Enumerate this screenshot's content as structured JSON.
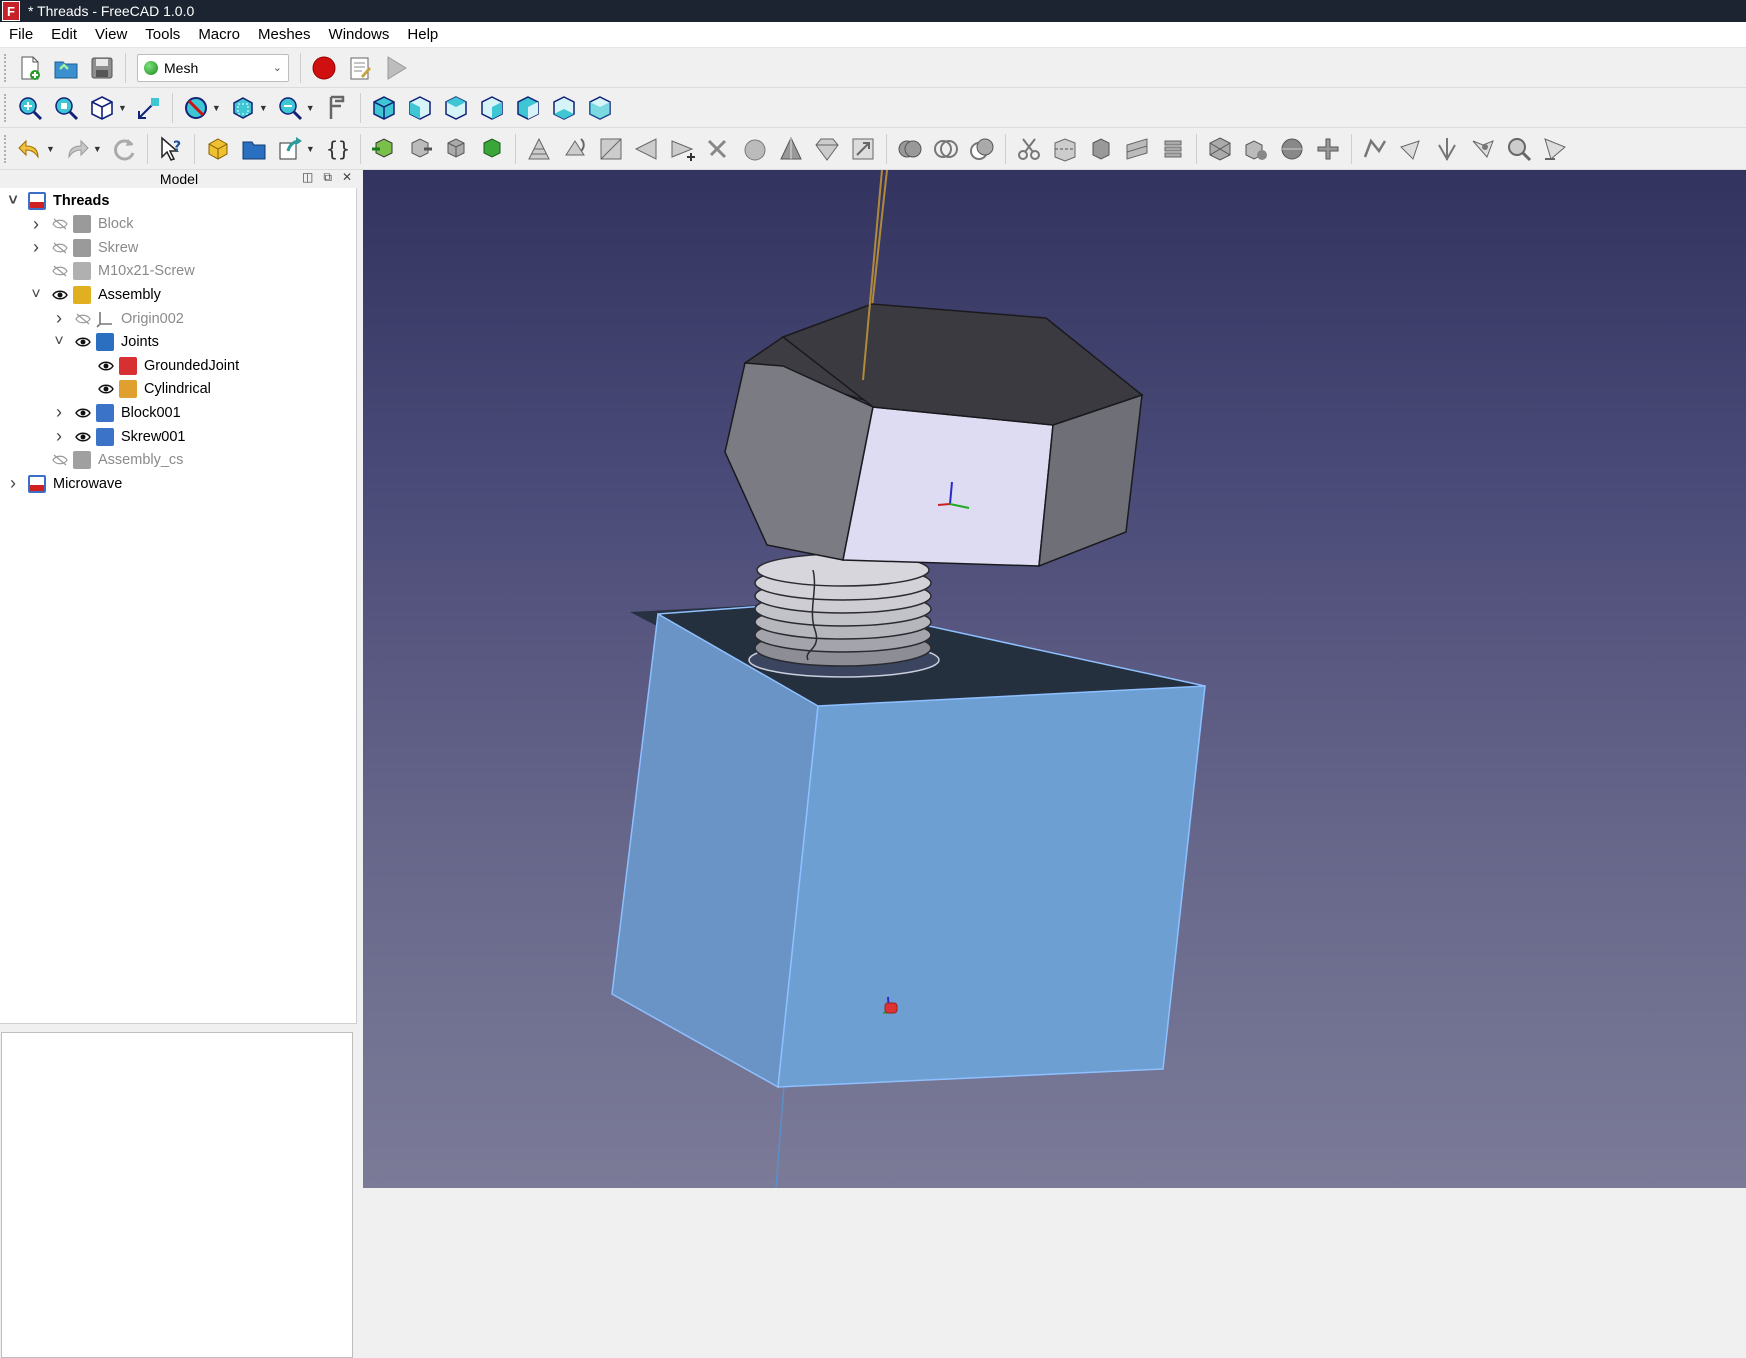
{
  "window": {
    "title": "* Threads - FreeCAD 1.0.0",
    "app_icon_letter": "F"
  },
  "menu": [
    "File",
    "Edit",
    "View",
    "Tools",
    "Macro",
    "Meshes",
    "Windows",
    "Help"
  ],
  "workbench": {
    "selected": "Mesh"
  },
  "model_panel": {
    "title": "Model"
  },
  "tree": [
    {
      "label": "Threads",
      "level": 0,
      "expander": "expanded",
      "visible": null,
      "icon": "document-icon",
      "style": "bold"
    },
    {
      "label": "Block",
      "level": 1,
      "expander": "collapsed",
      "visible": false,
      "icon": "solid-icon",
      "style": "hidden"
    },
    {
      "label": "Skrew",
      "level": 1,
      "expander": "collapsed",
      "visible": false,
      "icon": "solid-icon",
      "style": "hidden"
    },
    {
      "label": "M10x21-Screw",
      "level": 1,
      "expander": "none",
      "visible": false,
      "icon": "screw-icon",
      "style": "hidden"
    },
    {
      "label": "Assembly",
      "level": 1,
      "expander": "expanded",
      "visible": true,
      "icon": "assembly-icon",
      "style": "normal"
    },
    {
      "label": "Origin002",
      "level": 2,
      "expander": "collapsed",
      "visible": false,
      "icon": "origin-icon",
      "style": "hidden"
    },
    {
      "label": "Joints",
      "level": 2,
      "expander": "expanded",
      "visible": true,
      "icon": "joints-folder-icon",
      "style": "normal"
    },
    {
      "label": "GroundedJoint",
      "level": 3,
      "expander": "none",
      "visible": true,
      "icon": "grounded-joint-icon",
      "style": "normal"
    },
    {
      "label": "Cylindrical",
      "level": 3,
      "expander": "none",
      "visible": true,
      "icon": "cylindrical-joint-icon",
      "style": "normal"
    },
    {
      "label": "Block001",
      "level": 2,
      "expander": "collapsed",
      "visible": true,
      "icon": "link-icon",
      "style": "normal"
    },
    {
      "label": "Skrew001",
      "level": 2,
      "expander": "collapsed",
      "visible": true,
      "icon": "link-icon",
      "style": "normal"
    },
    {
      "label": "Assembly_cs",
      "level": 1,
      "expander": "none",
      "visible": false,
      "icon": "coordinate-system-icon",
      "style": "hidden"
    },
    {
      "label": "Microwave",
      "level": 0,
      "expander": "collapsed",
      "visible": null,
      "icon": "document-icon",
      "style": "normal"
    }
  ],
  "colors": {
    "accent": "#2fb8c8",
    "titlebar": "#1b2430",
    "viewport_top": "#33335f",
    "viewport_bottom": "#7b7b98",
    "block_face": "#6b9fd6",
    "record": "#d01010"
  }
}
